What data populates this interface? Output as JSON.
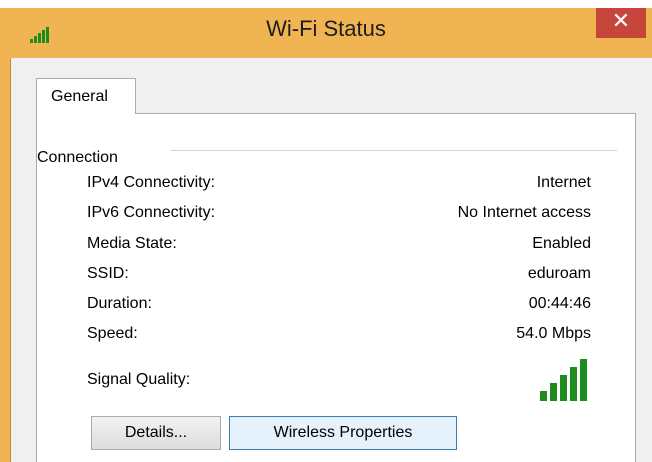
{
  "window": {
    "title": "Wi-Fi Status",
    "close_glyph": "✕",
    "close_color": "#c7463c",
    "frame_color": "#f0b552"
  },
  "tabs": [
    {
      "label": "General",
      "selected": true
    }
  ],
  "connection": {
    "group_label": "Connection",
    "rows": [
      {
        "label": "IPv4 Connectivity:",
        "value": "Internet"
      },
      {
        "label": "IPv6 Connectivity:",
        "value": "No Internet access"
      },
      {
        "label": "Media State:",
        "value": "Enabled"
      },
      {
        "label": "SSID:",
        "value": "eduroam"
      },
      {
        "label": "Duration:",
        "value": "00:44:46"
      },
      {
        "label": "Speed:",
        "value": "54.0 Mbps"
      }
    ],
    "signal_label": "Signal Quality:",
    "signal_bars_filled": 5,
    "signal_bars_total": 5,
    "signal_color": "#1e8c1e"
  },
  "buttons": {
    "details": "Details...",
    "wireless_properties": "Wireless Properties"
  },
  "icons": {
    "app_icon": "wifi-signal-icon",
    "signal_icon": "signal-strength-icon",
    "close_icon": "close-icon"
  }
}
